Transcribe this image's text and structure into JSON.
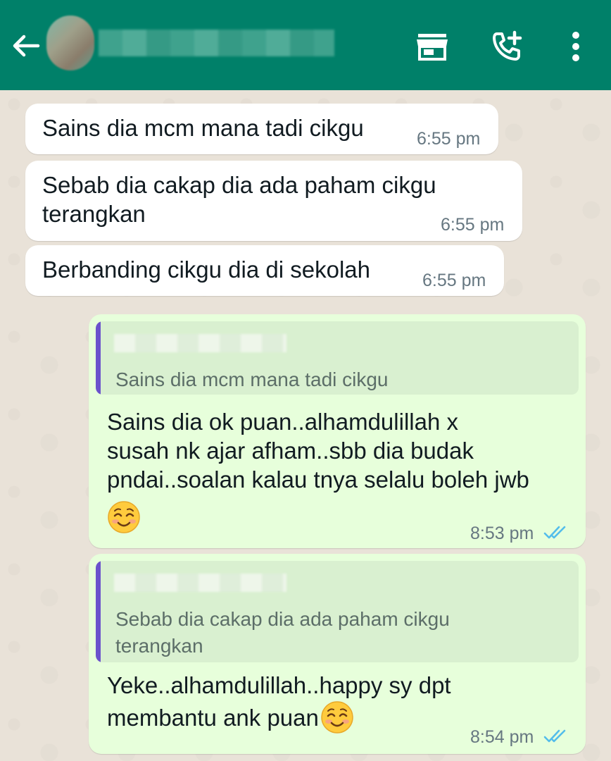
{
  "header": {
    "contact_name": "",
    "icons": {
      "back": "arrow-left-icon",
      "store": "storefront-icon",
      "call": "add-call-icon",
      "menu": "more-vert-icon"
    },
    "colors": {
      "appbar": "#008069",
      "incoming_bubble": "#ffffff",
      "outgoing_bubble": "#E7FFDB",
      "quote_bar": "#6B52CC",
      "ticks": "#53BDEB"
    }
  },
  "messages": [
    {
      "direction": "incoming",
      "text": "Sains dia mcm mana tadi cikgu",
      "time": "6:55 pm"
    },
    {
      "direction": "incoming",
      "text_line1": "Sebab dia cakap dia ada paham cikgu",
      "text_line2": "terangkan",
      "time": "6:55 pm"
    },
    {
      "direction": "incoming",
      "text": "Berbanding cikgu dia di sekolah",
      "time": "6:55 pm"
    },
    {
      "direction": "outgoing",
      "quoted_text": "Sains dia mcm mana tadi cikgu",
      "text_line1": "Sains dia ok puan..alhamdulillah x",
      "text_line2": "susah nk ajar afham..sbb dia budak",
      "text_line3": "pndai..soalan kalau tnya selalu boleh jwb",
      "emoji": "smiling-face-icon",
      "time": "8:53 pm",
      "status": "read"
    },
    {
      "direction": "outgoing",
      "quoted_line1": "Sebab dia cakap dia ada paham cikgu",
      "quoted_line2": "terangkan",
      "text_line1": "Yeke..alhamdulillah..happy  sy dpt",
      "text_line2": "membantu ank puan",
      "emoji": "smiling-face-icon",
      "time": "8:54 pm",
      "status": "read"
    }
  ]
}
